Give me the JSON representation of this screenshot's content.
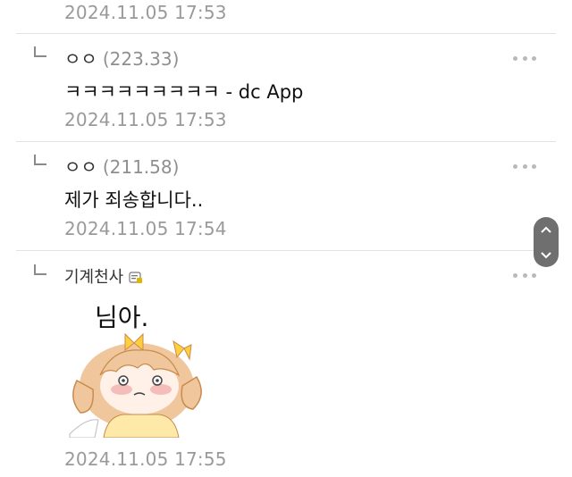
{
  "comments": [
    {
      "timestamp": "2024.11.05 17:53"
    },
    {
      "author": "ㅇㅇ",
      "ip": "(223.33)",
      "text": "ㅋㅋㅋㅋㅋㅋㅋㅋㅋ - dc App",
      "timestamp": "2024.11.05 17:53"
    },
    {
      "author": "ㅇㅇ",
      "ip": "(211.58)",
      "text": "제가 죄송합니다..",
      "timestamp": "2024.11.05 17:54"
    },
    {
      "author": "기계천사",
      "sticker_caption": "님아.",
      "timestamp": "2024.11.05 17:55"
    }
  ],
  "icons": {
    "reply": "reply-arrow-icon",
    "more": "more-dots-icon",
    "badge": "gallery-member-badge-icon",
    "scroll_up": "chevron-up-icon",
    "scroll_down": "chevron-down-icon"
  },
  "colors": {
    "timestamp": "#9a9a9a",
    "ip": "#8f8f8f",
    "scroll_button": "#6f6f6f",
    "badge_accent": "#e2b400"
  }
}
